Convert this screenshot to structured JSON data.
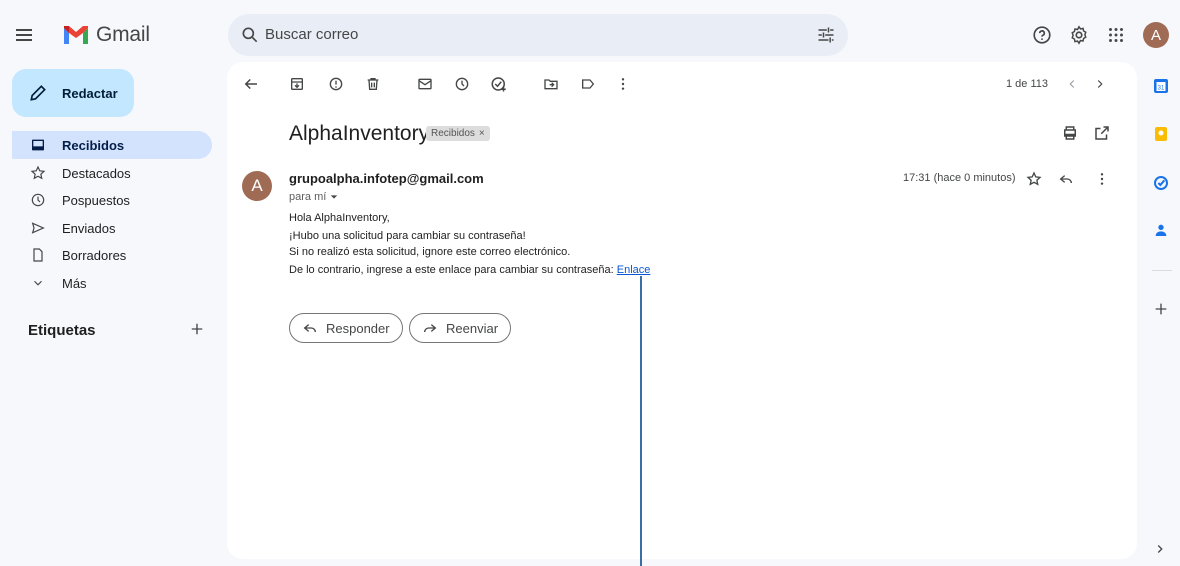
{
  "app": {
    "name": "Gmail",
    "avatar_letter": "A"
  },
  "search": {
    "placeholder": "Buscar correo"
  },
  "sidebar": {
    "compose_label": "Redactar",
    "items": [
      {
        "label": "Recibidos",
        "icon": "inbox-icon",
        "active": true
      },
      {
        "label": "Destacados",
        "icon": "star-icon"
      },
      {
        "label": "Pospuestos",
        "icon": "clock-icon"
      },
      {
        "label": "Enviados",
        "icon": "send-icon"
      },
      {
        "label": "Borradores",
        "icon": "draft-icon"
      },
      {
        "label": "Más",
        "icon": "chevron-down-icon"
      }
    ],
    "labels_title": "Etiquetas"
  },
  "toolbar": {
    "pager": "1 de 113"
  },
  "email": {
    "subject": "AlphaInventory",
    "chip": "Recibidos",
    "chip_close": "×",
    "sender_initial": "A",
    "sender": "grupoalpha.infotep@gmail.com",
    "to": "para mí",
    "time": "17:31 (hace 0 minutos)",
    "body": {
      "line1": "Hola AlphaInventory,",
      "line2": "¡Hubo una solicitud para cambiar su contraseña!",
      "line3": "Si no realizó esta solicitud, ignore este correo electrónico.",
      "line4": "De lo contrario, ingrese a este enlace para cambiar su contraseña: ",
      "link": "Enlace"
    },
    "reply_label": "Responder",
    "forward_label": "Reenviar"
  },
  "colors": {
    "accent": "#0b57d0",
    "compose_bg": "#c2e7ff",
    "active_bg": "#d3e3fd",
    "avatar": "#9f6b55"
  }
}
